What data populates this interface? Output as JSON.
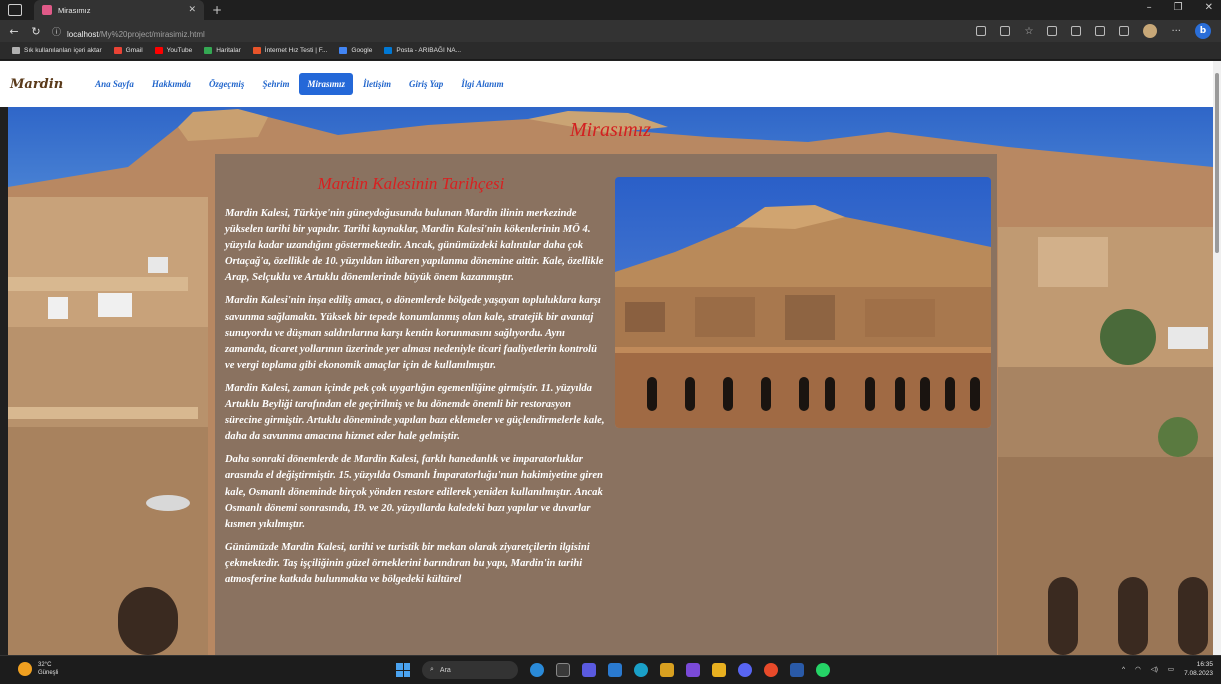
{
  "browser": {
    "tab_title": "Mirasımız",
    "url_host": "localhost",
    "url_path": "/My%20project/mirasimiz.html",
    "bookmarks": [
      {
        "label": "Sık kullanılanları içeri aktar",
        "color": "#b0b0b0"
      },
      {
        "label": "Gmail",
        "color": "#ea4335"
      },
      {
        "label": "YouTube",
        "color": "#ff0000"
      },
      {
        "label": "Haritalar",
        "color": "#34a853"
      },
      {
        "label": "İnternet Hız Testi | F...",
        "color": "#e8542a"
      },
      {
        "label": "Google",
        "color": "#4285f4"
      },
      {
        "label": "Posta - ARIBAĞI NA...",
        "color": "#0078d4"
      }
    ]
  },
  "site": {
    "logo": "Mardin",
    "nav": [
      {
        "label": "Ana Sayfa",
        "active": false
      },
      {
        "label": "Hakkımda",
        "active": false
      },
      {
        "label": "Özgeçmiş",
        "active": false
      },
      {
        "label": "Şehrim",
        "active": false
      },
      {
        "label": "Mirasımız",
        "active": true
      },
      {
        "label": "İletişim",
        "active": false
      },
      {
        "label": "Giriş Yap",
        "active": false
      },
      {
        "label": "İlgi Alanım",
        "active": false
      }
    ],
    "hero_title": "Mirasımız",
    "article_title": "Mardin Kalesinin Tarihçesi",
    "paragraphs": [
      "Mardin Kalesi, Türkiye'nin güneydoğusunda bulunan Mardin ilinin merkezinde yükselen tarihi bir yapıdır. Tarihi kaynaklar, Mardin Kalesi'nin kökenlerinin MÖ 4. yüzyıla kadar uzandığını göstermektedir. Ancak, günümüzdeki kalıntılar daha çok Ortaçağ'a, özellikle de 10. yüzyıldan itibaren yapılanma dönemine aittir. Kale, özellikle Arap, Selçuklu ve Artuklu dönemlerinde büyük önem kazanmıştır.",
      "Mardin Kalesi'nin inşa ediliş amacı, o dönemlerde bölgede yaşayan topluluklara karşı savunma sağlamaktı. Yüksek bir tepede konumlanmış olan kale, stratejik bir avantaj sunuyordu ve düşman saldırılarına karşı kentin korunmasını sağlıyordu. Aynı zamanda, ticaret yollarının üzerinde yer alması nedeniyle ticari faaliyetlerin kontrolü ve vergi toplama gibi ekonomik amaçlar için de kullanılmıştır.",
      "Mardin Kalesi, zaman içinde pek çok uygarlığın egemenliğine girmiştir. 11. yüzyılda Artuklu Beyliği tarafından ele geçirilmiş ve bu dönemde önemli bir restorasyon sürecine girmiştir. Artuklu döneminde yapılan bazı eklemeler ve güçlendirmelerle kale, daha da savunma amacına hizmet eder hale gelmiştir.",
      "Daha sonraki dönemlerde de Mardin Kalesi, farklı hanedanlık ve imparatorluklar arasında el değiştirmiştir. 15. yüzyılda Osmanlı İmparatorluğu'nun hakimiyetine giren kale, Osmanlı döneminde birçok yönden restore edilerek yeniden kullanılmıştır. Ancak Osmanlı dönemi sonrasında, 19. ve 20. yüzyıllarda kaledeki bazı yapılar ve duvarlar kısmen yıkılmıştır.",
      "Günümüzde Mardin Kalesi, tarihi ve turistik bir mekan olarak ziyaretçilerin ilgisini çekmektedir. Taş işçiliğinin güzel örneklerini barındıran bu yapı, Mardin'in tarihi atmosferine katkıda bulunmakta ve bölgedeki kültürel"
    ]
  },
  "taskbar": {
    "temperature": "32°C",
    "weather": "Güneşli",
    "search": "Ara",
    "time": "16:35",
    "date": "7.08.2023"
  }
}
